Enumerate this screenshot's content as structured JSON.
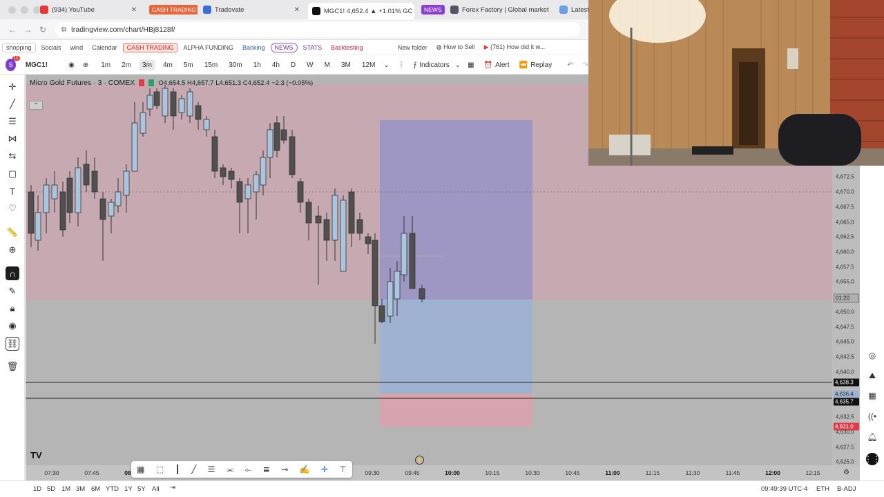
{
  "browser": {
    "tabs": [
      {
        "label": "(934) YouTube",
        "icon": "youtube-icon"
      },
      {
        "label": "CASH TRADING",
        "icon": "pill"
      },
      {
        "label": "Tradovate",
        "icon": "tradovate-icon"
      },
      {
        "label": "MGC1! 4,652.4 ▲ +1.01% GC",
        "icon": "tradingview-icon"
      },
      {
        "label": "NEWS",
        "icon": "pill"
      },
      {
        "label": "Forex Factory | Global market",
        "icon": "forexfactory-icon"
      },
      {
        "label": "Latest",
        "icon": "page-icon"
      }
    ],
    "url": "tradingview.com/chart/HBj8128f/",
    "bookmarks": [
      "shopping",
      "Socials",
      "wind",
      "Calendar",
      "CASH TRADING",
      "ALPHA FUNDING",
      "Banking",
      "NEWS",
      "STATS",
      "Backtesting",
      "New folder",
      "How to Sell",
      "(761) How did it w..."
    ],
    "badge_count": "11"
  },
  "toolbar": {
    "symbol": "MGC1!",
    "intervals": [
      "1m",
      "2m",
      "3m",
      "4m",
      "5m",
      "15m",
      "30m",
      "1h",
      "4h",
      "D",
      "W",
      "M",
      "3M",
      "12M"
    ],
    "selected_interval": "3m",
    "indicators_label": "Indicators",
    "alert_label": "Alert",
    "replay_label": "Replay"
  },
  "legend": {
    "title": "Micro Gold Futures · 3 · COMEX",
    "ohlc": "O4,654.5 H4,657.7 L4,651.3 C4,652.4 −2.3 (−0.05%)"
  },
  "price_axis": [
    "4,672.5",
    "4,670.0",
    "4,667.5",
    "4,665.0",
    "4,662.5",
    "4,660.0",
    "4,657.5",
    "4,655.0",
    "4,650.0",
    "4,647.5",
    "4,645.0",
    "4,642.5",
    "4,640.0",
    "4,632.5",
    "4,630.0",
    "4,627.5",
    "4,625.0"
  ],
  "price_tags": {
    "countdown": "01:20",
    "line1": "4,638.3",
    "line2": "4,635.7",
    "stop": "4,631.0",
    "mid": "4,636.4"
  },
  "time_axis": [
    "07:30",
    "07:45",
    "08",
    "09:30",
    "09:45",
    "10:00",
    "10:15",
    "10:30",
    "10:45",
    "11:00",
    "11:15",
    "11:30",
    "11:45",
    "12:00",
    "12:15"
  ],
  "bottom": {
    "ranges": [
      "1D",
      "5D",
      "1M",
      "3M",
      "6M",
      "YTD",
      "1Y",
      "5Y",
      "All"
    ],
    "clock": "09:49:39 UTC-4",
    "symbol_info": "ETH",
    "adj": "B-ADJ"
  },
  "colors": {
    "up_fill": "#aac6de",
    "down_fill": "#505050",
    "long_zone": "#9fb1d4",
    "stop_zone": "#d6a3ae",
    "red_tag": "#e23a4a",
    "accent": "#2962ff"
  }
}
